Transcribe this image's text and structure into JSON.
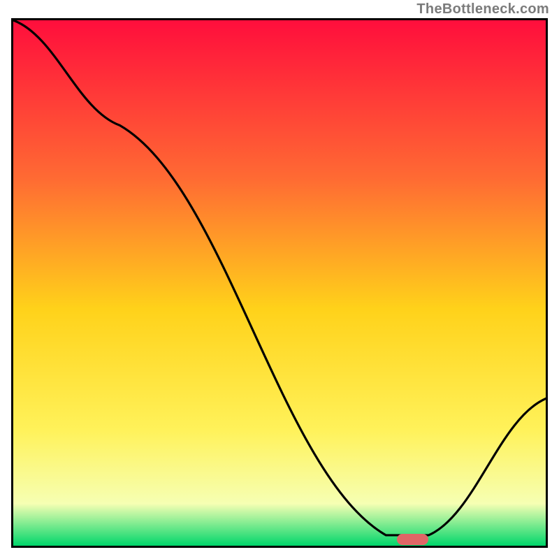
{
  "attribution": "TheBottleneck.com",
  "colors": {
    "bg_top": "#ff0e3c",
    "bg_mid1": "#ff6a33",
    "bg_mid2": "#ffd21a",
    "bg_mid3": "#fff25a",
    "bg_mid4": "#f6ffb3",
    "bg_bottom": "#00d66b",
    "curve": "#000000",
    "marker": "#e06666",
    "border": "#000000"
  },
  "chart_data": {
    "type": "line",
    "title": "",
    "xlabel": "",
    "ylabel": "",
    "xlim": [
      0,
      100
    ],
    "ylim": [
      0,
      100
    ],
    "x": [
      0,
      20,
      70,
      78,
      100
    ],
    "values": [
      100,
      80,
      2,
      2,
      28
    ],
    "marker_range_x": [
      72,
      78
    ],
    "marker_y": 1.2,
    "notes": "Values are normalized: 0 = bottom (green), 100 = top (red). Curve is a stylized bottleneck curve with a flat minimum between x≈72 and x≈78."
  }
}
